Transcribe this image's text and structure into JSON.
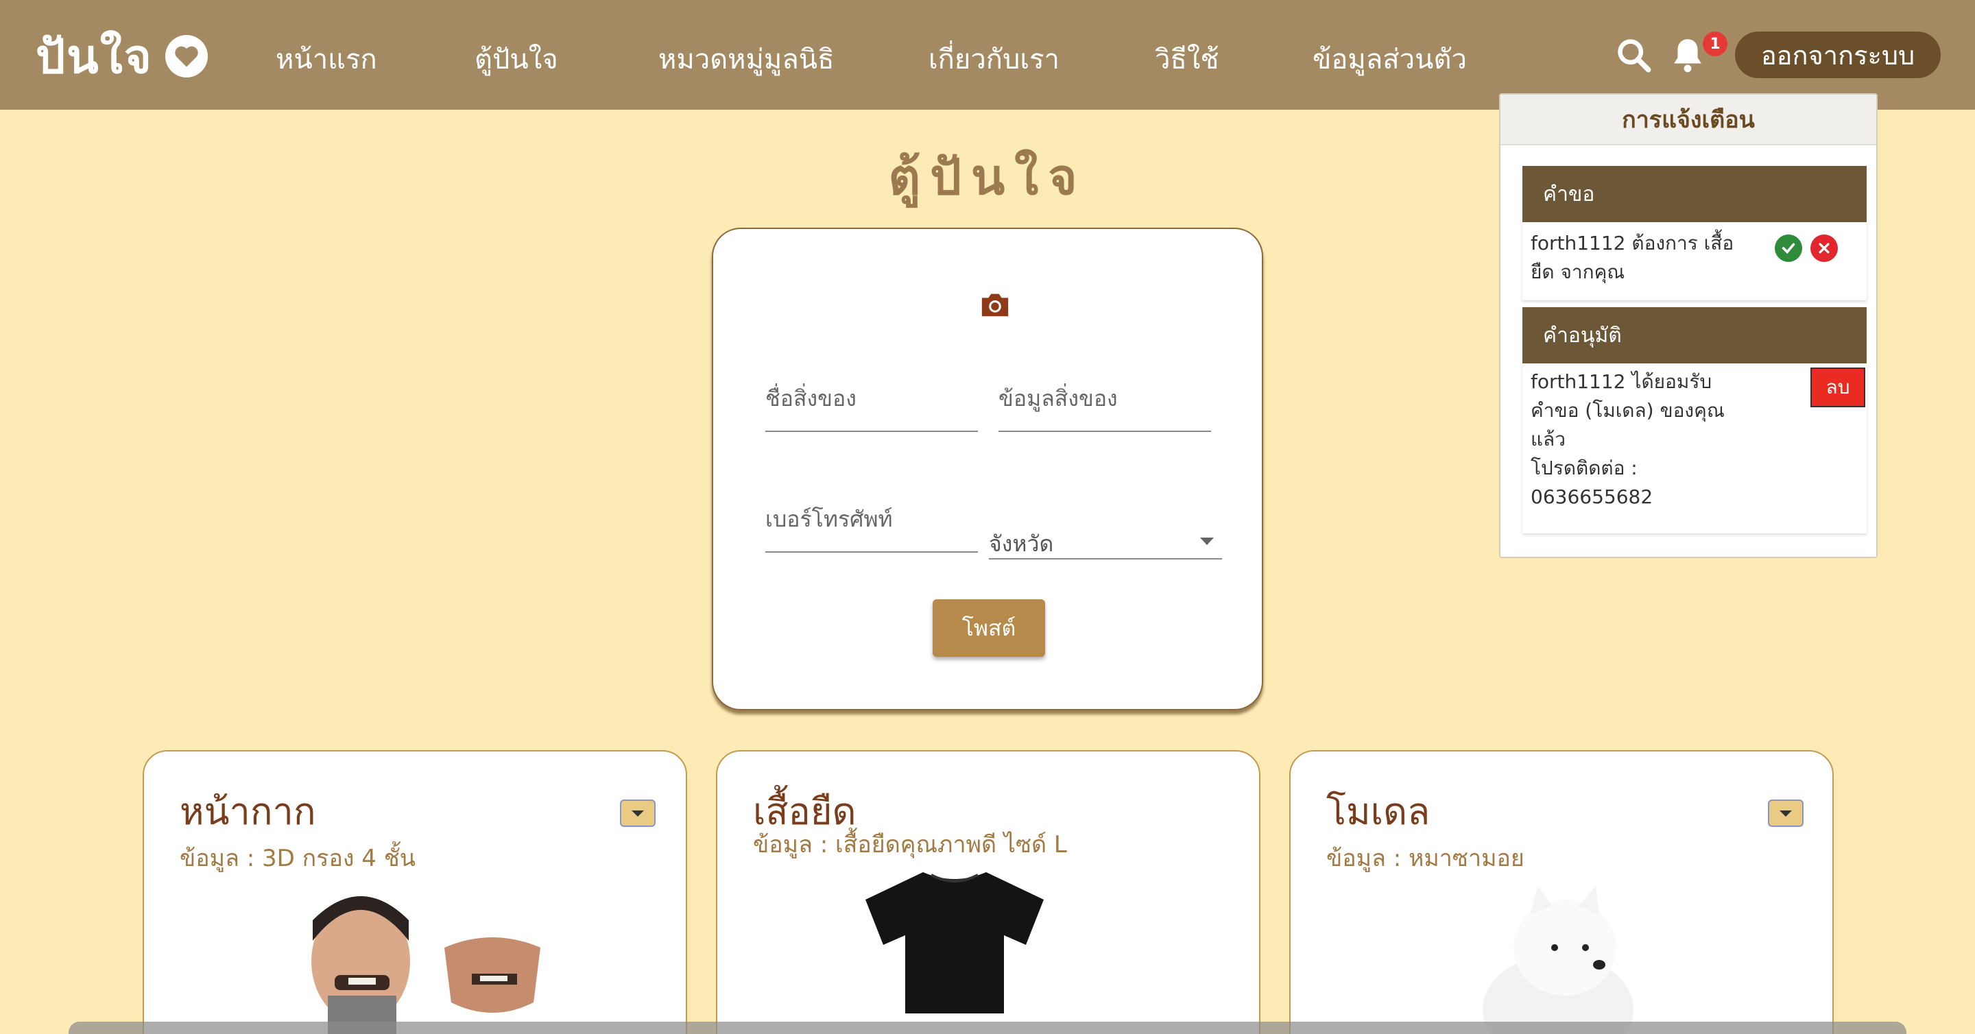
{
  "brand": {
    "name": "ปันใจ"
  },
  "nav": {
    "links": [
      "หน้าแรก",
      "ตู้ปันใจ",
      "หมวดหมู่มูลนิธิ",
      "เกี่ยวกับเรา",
      "วิธีใช้",
      "ข้อมูลส่วนตัว"
    ],
    "notification_count": "1",
    "logout_label": "ออกจากระบบ"
  },
  "page": {
    "title": "ตู้ปันใจ"
  },
  "form": {
    "item_name_placeholder": "ชื่อสิ่งของ",
    "item_info_placeholder": "ข้อมูลสิ่งของ",
    "phone_placeholder": "เบอร์โทรศัพท์",
    "province_label": "จังหวัด",
    "post_label": "โพสต์"
  },
  "notifications": {
    "title": "การแจ้งเตือน",
    "requests_header": "คำขอ",
    "request_text_line1": "forth1112 ต้องการ เสื้อ",
    "request_text_line2": "ยืด จากคุณ",
    "approvals_header": "คำอนุมัติ",
    "approval_line1": "forth1112 ได้ยอมรับ",
    "approval_line2": "คำขอ (โมเดล) ของคุณ",
    "approval_line3": "แล้ว",
    "approval_line4": "โปรดติดต่อ :",
    "approval_line5": "0636655682",
    "delete_label": "ลบ"
  },
  "items": [
    {
      "title": "หน้ากาก",
      "desc": "ข้อมูล : 3D กรอง 4 ชั้น"
    },
    {
      "title": "เสื้อยืด",
      "desc": "ข้อมูล : เสื้อยืดคุณภาพดี ไซด์ L"
    },
    {
      "title": "โมเดล",
      "desc": "ข้อมูล : หมาซามอย"
    }
  ],
  "colors": {
    "navbar": "#A48A62",
    "background": "#FDEBB6",
    "logout": "#6b4f2a",
    "accent": "#B58A4A",
    "notif_section": "#6c5836",
    "delete": "#ea2b22"
  },
  "icons": [
    "heart-icon",
    "search-icon",
    "bell-icon",
    "camera-icon",
    "check-icon",
    "cancel-icon",
    "dropdown-caret-icon"
  ]
}
